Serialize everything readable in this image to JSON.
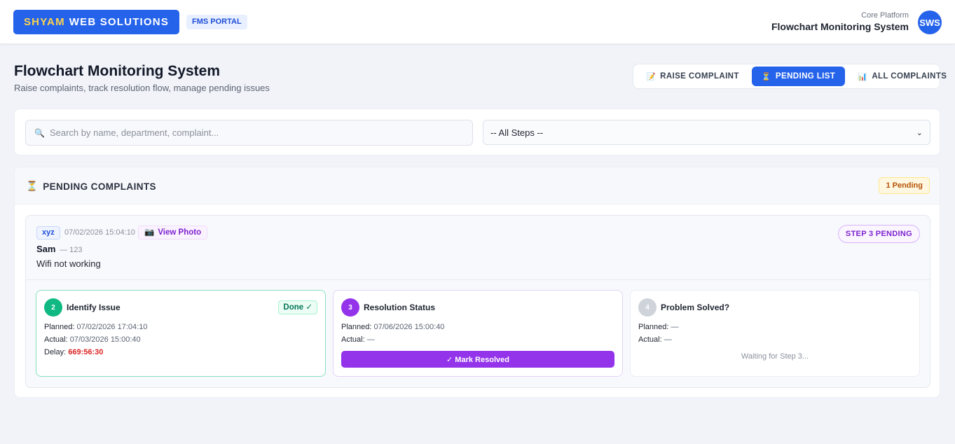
{
  "header": {
    "brand_highlight": "SHYAM",
    "brand_rest": "WEB SOLUTIONS",
    "portal_badge": "FMS PORTAL",
    "platform_sub": "Core Platform",
    "platform_title": "Flowchart Monitoring System",
    "avatar": "SWS"
  },
  "page": {
    "title": "Flowchart Monitoring System",
    "subtitle": "Raise complaints, track resolution flow, manage pending issues"
  },
  "nav": {
    "tabs": [
      {
        "label": "RAISE COMPLAINT",
        "icon": "📝",
        "active": false
      },
      {
        "label": "PENDING LIST",
        "icon": "⏳",
        "active": true
      },
      {
        "label": "ALL COMPLAINTS",
        "icon": "📊",
        "active": false
      }
    ]
  },
  "filters": {
    "search_icon": "🔍",
    "search_placeholder": "Search by name, department, complaint...",
    "step_selected": "-- All Steps --"
  },
  "pending": {
    "title_icon": "⏳",
    "title": "PENDING COMPLAINTS",
    "count_badge": "1 Pending",
    "card": {
      "tag": "xyz",
      "timestamp": "07/02/2026 15:04:10",
      "photo_icon": "📷",
      "photo_label": "View Photo",
      "name": "Sam",
      "id_text": "— 123",
      "complaint": "Wifi not working",
      "status_badge": "STEP 3 PENDING",
      "steps": [
        {
          "num": "2",
          "title": "Identify Issue",
          "done_label": "Done ✓",
          "planned_label": "Planned:",
          "planned": "07/02/2026 17:04:10",
          "actual_label": "Actual:",
          "actual": "07/03/2026 15:00:40",
          "delay_label": "Delay:",
          "delay": "669:56:30"
        },
        {
          "num": "3",
          "title": "Resolution Status",
          "planned_label": "Planned:",
          "planned": "07/06/2026 15:00:40",
          "actual_label": "Actual:",
          "actual": "—",
          "action_label": "✓ Mark Resolved"
        },
        {
          "num": "4",
          "title": "Problem Solved?",
          "planned_label": "Planned:",
          "planned": "—",
          "actual_label": "Actual:",
          "actual": "—",
          "waiting": "Waiting for Step 3..."
        }
      ]
    }
  },
  "colors": {
    "primary": "#2563eb",
    "success": "#10b981",
    "purple": "#9333ea",
    "delay": "#dc2626",
    "warning": "#b45309"
  }
}
